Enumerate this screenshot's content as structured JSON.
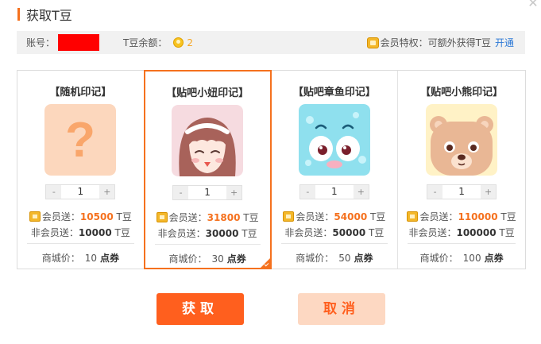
{
  "dialog": {
    "title": "获取T豆",
    "close_icon": "close-icon"
  },
  "info_bar": {
    "account_label": "账号：",
    "balance_label": "T豆余额：",
    "balance_value": "2",
    "vip_text": "会员特权：可额外获得T豆",
    "open_link": "开通"
  },
  "cards": [
    {
      "name": "【随机印记】",
      "avatar_icon": "question-mark-icon",
      "quantity": "1",
      "vip_label": "会员送：",
      "vip_value": "10500",
      "vip_unit": "T豆",
      "nonvip_label": "非会员送：",
      "nonvip_value": "10000",
      "nonvip_unit": "T豆",
      "price_label": "商城价：",
      "price_value": "10",
      "price_unit": "点券"
    },
    {
      "name": "【贴吧小妞印记】",
      "avatar_icon": "girl-face-icon",
      "quantity": "1",
      "vip_label": "会员送：",
      "vip_value": "31800",
      "vip_unit": "T豆",
      "nonvip_label": "非会员送：",
      "nonvip_value": "30000",
      "nonvip_unit": "T豆",
      "price_label": "商城价：",
      "price_value": "30",
      "price_unit": "点券"
    },
    {
      "name": "【贴吧章鱼印记】",
      "avatar_icon": "octopus-face-icon",
      "quantity": "1",
      "vip_label": "会员送：",
      "vip_value": "54000",
      "vip_unit": "T豆",
      "nonvip_label": "非会员送：",
      "nonvip_value": "50000",
      "nonvip_unit": "T豆",
      "price_label": "商城价：",
      "price_value": "50",
      "price_unit": "点券"
    },
    {
      "name": "【贴吧小熊印记】",
      "avatar_icon": "bear-face-icon",
      "quantity": "1",
      "vip_label": "会员送：",
      "vip_value": "110000",
      "vip_unit": "T豆",
      "nonvip_label": "非会员送：",
      "nonvip_value": "100000",
      "nonvip_unit": "T豆",
      "price_label": "商城价：",
      "price_value": "100",
      "price_unit": "点券"
    }
  ],
  "stepper": {
    "minus": "-",
    "plus": "+"
  },
  "selected_card_index": 1,
  "buttons": {
    "get": "获取",
    "cancel": "取消"
  },
  "colors": {
    "accent": "#f5711e",
    "primary_button": "#ff5f1e",
    "secondary_button_bg": "#fdd8c2",
    "link": "#2d79d6",
    "redaction": "#ff0000"
  }
}
